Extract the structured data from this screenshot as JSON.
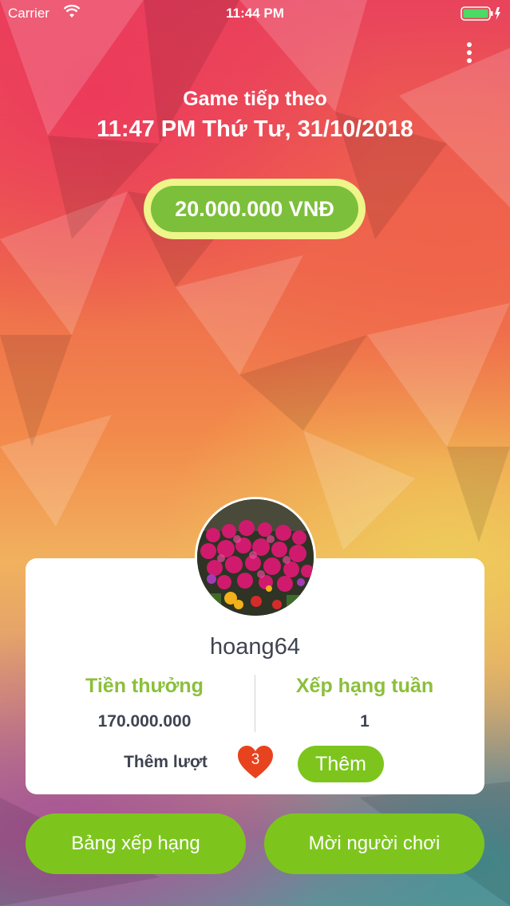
{
  "status_bar": {
    "carrier": "Carrier",
    "time": "11:44 PM",
    "battery_color": "#4cd964"
  },
  "header": {
    "menu_icon": "more-vertical-icon",
    "next_game_label": "Game tiếp theo",
    "next_game_datetime": "11:47 PM Thứ Tư, 31/10/2018",
    "prize": "20.000.000 VNĐ"
  },
  "profile": {
    "username": "hoang64",
    "reward_label": "Tiền thưởng",
    "reward_value": "170.000.000",
    "weekly_rank_label": "Xếp hạng tuần",
    "weekly_rank_value": "1",
    "add_turns_label": "Thêm lượt",
    "lives": "3",
    "add_button": "Thêm"
  },
  "actions": {
    "leaderboard": "Bảng xếp hạng",
    "invite": "Mời người chơi"
  },
  "colors": {
    "accent_green": "#7dc51d",
    "label_green": "#8bbf3b",
    "heart": "#e8431f",
    "prize_outline": "#eef58a"
  }
}
